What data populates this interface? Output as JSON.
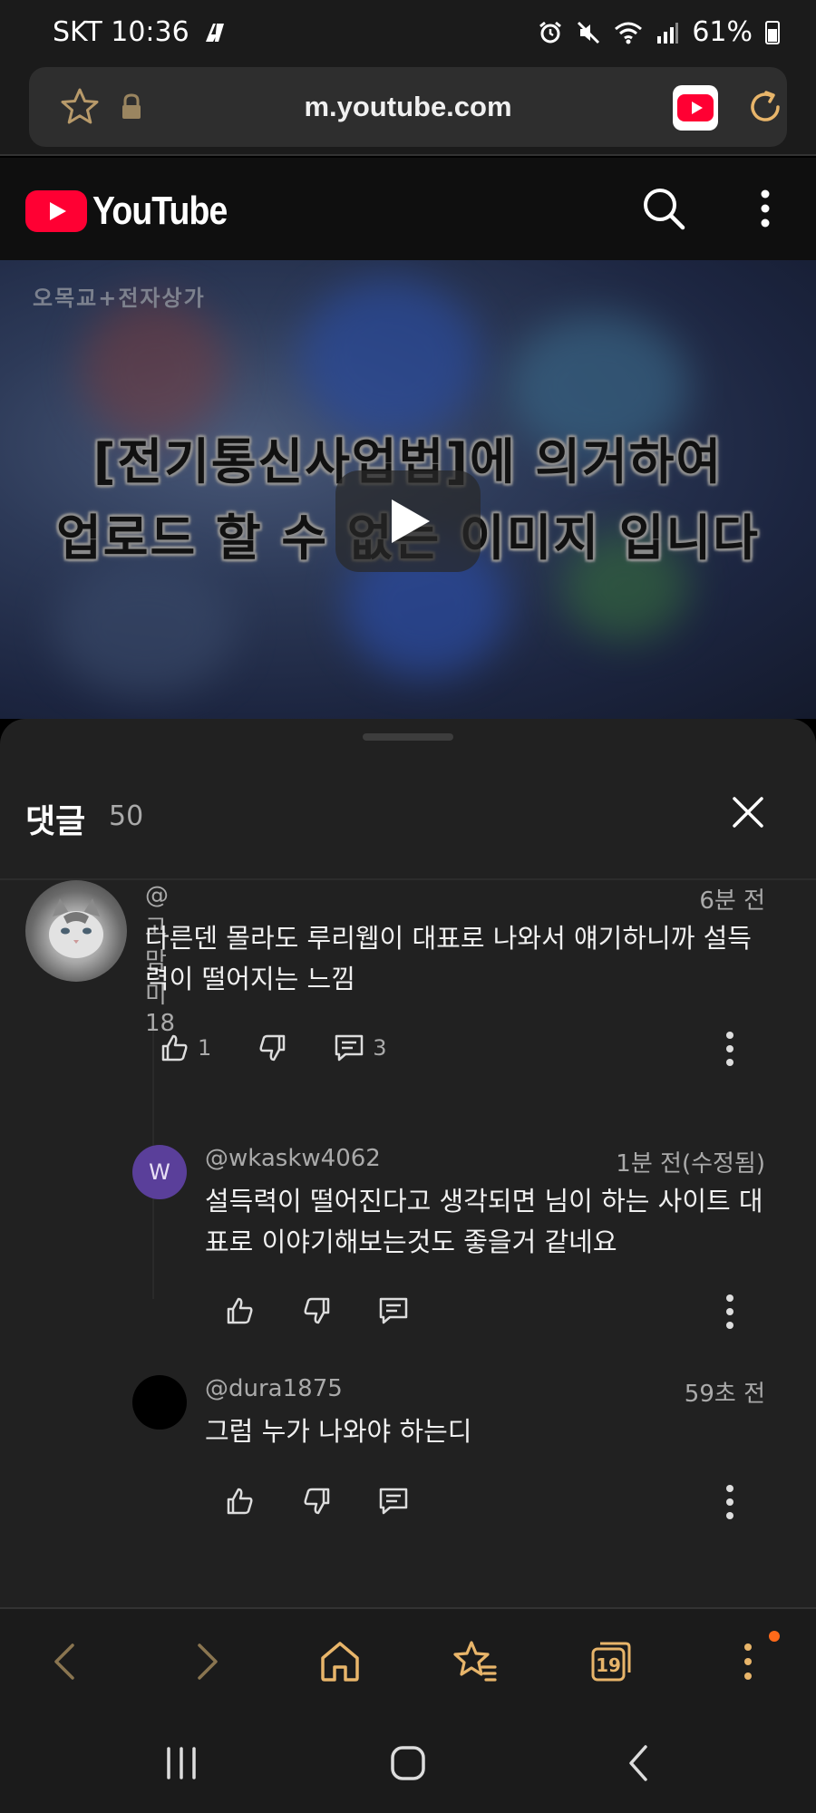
{
  "status_bar": {
    "carrier_time": "SKT 10:36",
    "battery": "61%"
  },
  "browser": {
    "url": "m.youtube.com"
  },
  "youtube": {
    "logo_text": "YouTube"
  },
  "video": {
    "watermark": "오목교+전자상가",
    "caption_line1": "[전기통신사업법]에 의거하여",
    "caption_line2": "업로드 할 수 없는 이미지 입니다"
  },
  "comments_panel": {
    "title": "댓글",
    "count": "50",
    "comments": [
      {
        "author": "@고맘미18",
        "time": "6분 전",
        "text": "다른덴 몰라도 루리웹이 대표로 나와서 얘기하니까 설득력이 떨어지는 느낌",
        "likes": "1",
        "replies": "3"
      },
      {
        "author": "@wkaskw4062",
        "avatar_letter": "W",
        "time": "1분 전(수정됨)",
        "text": "설득력이 떨어진다고 생각되면 님이 하는 사이트 대표로 이야기해보는것도 좋을거 같네요"
      },
      {
        "author": "@dura1875",
        "time": "59초 전",
        "text": "그럼 누가 나와야 하는디"
      }
    ]
  },
  "bottom_nav": {
    "tabs_count": "19"
  },
  "colors": {
    "youtube_red": "#ff0033",
    "browser_accent": "#e8b56a",
    "panel_bg": "#212121",
    "notification_dot": "#ff6a1a"
  }
}
